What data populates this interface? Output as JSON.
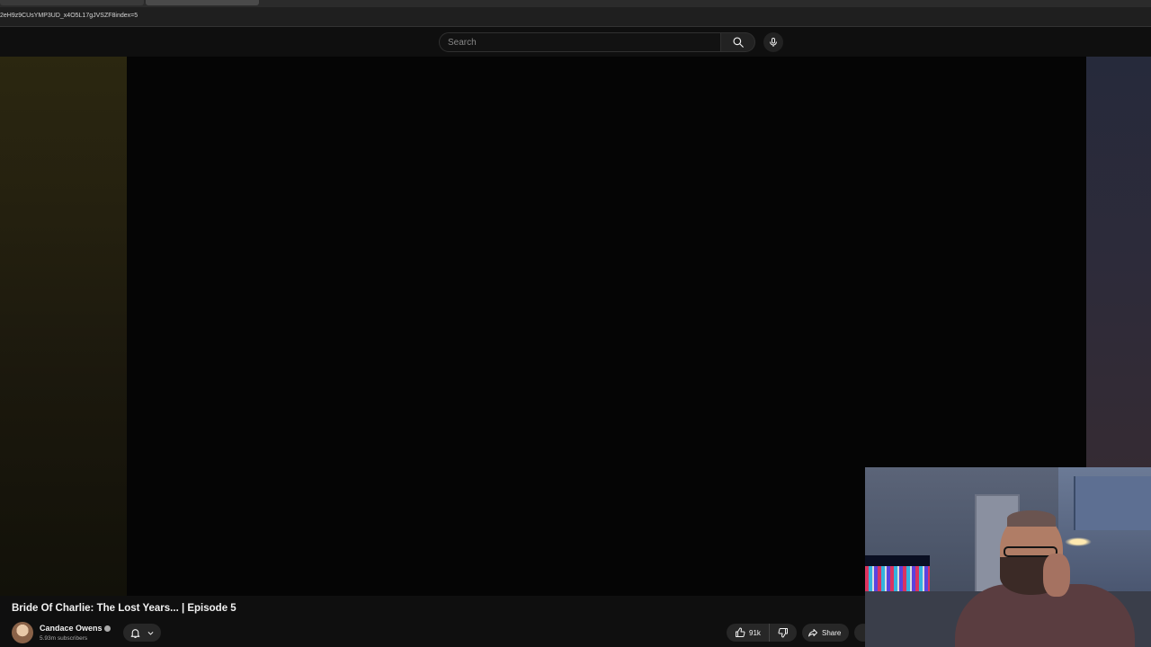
{
  "browser": {
    "url": "2eH9z9CUsYMP3UD_x4O5L17gJVSZF8index=5"
  },
  "header": {
    "search_placeholder": "Search",
    "search_icon": "search-icon",
    "mic_icon": "microphone-icon"
  },
  "video": {
    "title": "Bride Of Charlie: The Lost Years... | Episode 5",
    "channel_name": "Candace Owens",
    "subscribers": "5.93m subscribers",
    "likes": "91k",
    "share_label": "Share"
  },
  "colors": {
    "page_bg": "#0f0f0f",
    "button_bg": "#272727",
    "text_primary": "#f1f1f1",
    "text_secondary": "#aaaaaa"
  }
}
